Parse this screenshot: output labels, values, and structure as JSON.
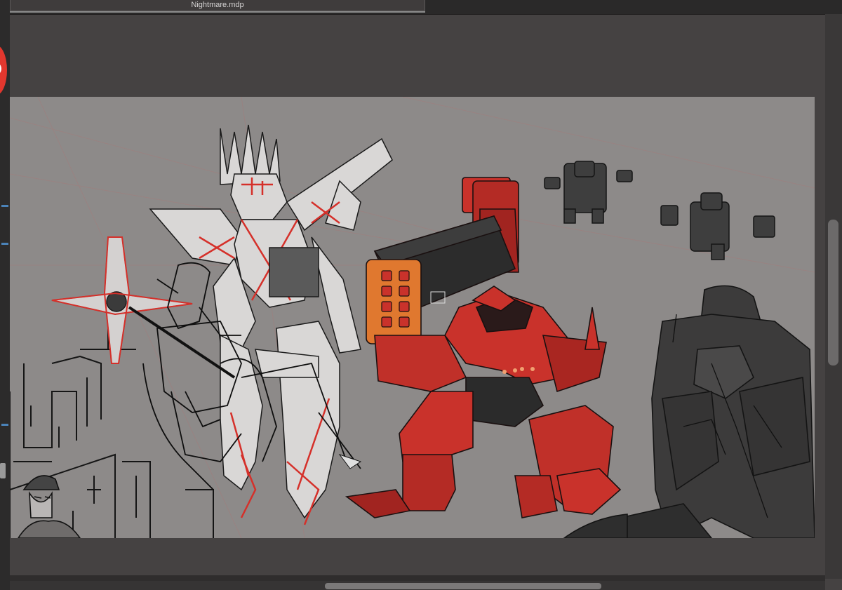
{
  "window": {
    "document_tab_title": "Nightmare.mdp"
  },
  "colors": {
    "workspace": "#454242",
    "canvas_paper": "#8d8a89",
    "accent_red": "#c9322b",
    "mech_orange": "#e0782f",
    "silhouette_dark": "#3b3b3b",
    "sketch_white": "#d9d7d6"
  },
  "canvas": {
    "artwork_description_icon": "artwork-canvas-icon"
  }
}
